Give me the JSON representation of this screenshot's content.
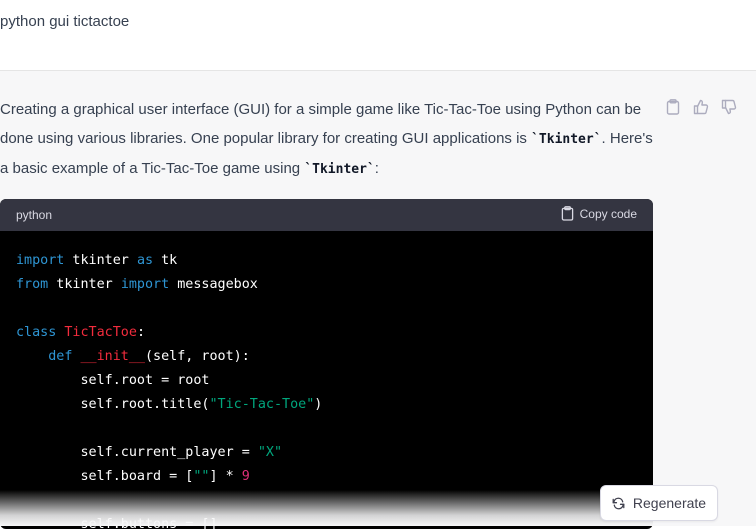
{
  "user": {
    "prompt": "python gui tictactoe"
  },
  "assistant": {
    "intro_1": "Creating a graphical user interface (GUI) for a simple game like Tic-Tac-Toe using Python can be done using various libraries. One popular library for creating GUI applications is ",
    "inline_code_1": "`Tkinter`",
    "intro_2": ". Here's a basic example of a Tic-Tac-Toe game using ",
    "inline_code_2": "`Tkinter`",
    "intro_3": ":",
    "actions": [
      "clipboard-icon",
      "thumbs-up-icon",
      "thumbs-down-icon"
    ]
  },
  "code_block": {
    "language": "python",
    "copy_label": "Copy code",
    "lines": [
      [
        [
          "kw",
          "import"
        ],
        [
          "p",
          " tkinter "
        ],
        [
          "kw",
          "as"
        ],
        [
          "p",
          " tk"
        ]
      ],
      [
        [
          "kw",
          "from"
        ],
        [
          "p",
          " tkinter "
        ],
        [
          "kw",
          "import"
        ],
        [
          "p",
          " messagebox"
        ]
      ],
      [],
      [
        [
          "kw",
          "class"
        ],
        [
          "p",
          " "
        ],
        [
          "cls",
          "TicTacToe"
        ],
        [
          "p",
          ":"
        ]
      ],
      [
        [
          "p",
          "    "
        ],
        [
          "kw",
          "def"
        ],
        [
          "p",
          " "
        ],
        [
          "cls",
          "__init__"
        ],
        [
          "p",
          "(self, root):"
        ]
      ],
      [
        [
          "p",
          "        self.root = root"
        ]
      ],
      [
        [
          "p",
          "        self.root.title("
        ],
        [
          "str",
          "\"Tic-Tac-Toe\""
        ],
        [
          "p",
          ")"
        ]
      ],
      [],
      [
        [
          "p",
          "        self.current_player = "
        ],
        [
          "str",
          "\"X\""
        ]
      ],
      [
        [
          "p",
          "        self.board = ["
        ],
        [
          "str",
          "\"\""
        ],
        [
          "p",
          "] * "
        ],
        [
          "num",
          "9"
        ]
      ],
      [],
      [
        [
          "p",
          "        self.buttons = []"
        ]
      ]
    ]
  },
  "regenerate": {
    "label": "Regenerate"
  }
}
